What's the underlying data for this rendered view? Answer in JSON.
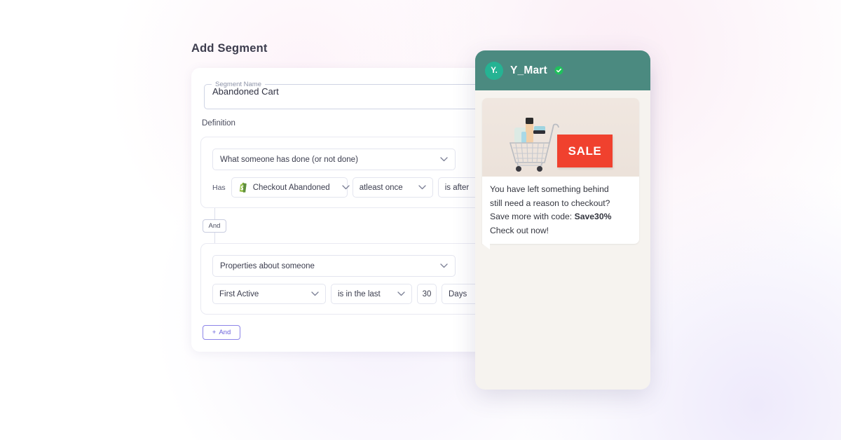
{
  "page": {
    "title": "Add Segment"
  },
  "segment_form": {
    "name_field": {
      "legend": "Segment Name",
      "value": "Abandoned Cart"
    },
    "definition_label": "Definition",
    "rules": [
      {
        "primary_select": "What someone has done (or not done)",
        "prefix_label": "Has",
        "event": "Checkout Abandoned",
        "event_icon": "shopify-icon",
        "frequency": "atleast once",
        "time_operator": "is after"
      },
      {
        "primary_select": "Properties about someone",
        "property": "First Active",
        "operator": "is in the last",
        "amount": "30",
        "unit": "Days"
      }
    ],
    "connector_label": "And",
    "add_condition_button": "+ And",
    "add_condition_plus": "+",
    "add_condition_text": "And"
  },
  "preview": {
    "brand": {
      "avatar_initials": "Y.",
      "name": "Y_Mart",
      "verified_icon": "verified-check-icon"
    },
    "message": {
      "image_alt": "shopping-cart-with-sale-sign",
      "sale_tag": "SALE",
      "line1": "You have left something behind",
      "line2": "still need a reason to checkout?",
      "line3_prefix": "Save more with code: ",
      "line3_code": "Save30%",
      "line4": "Check out now!"
    }
  },
  "colors": {
    "header_teal": "#4b8a80",
    "avatar_green": "#25b393",
    "verified_green": "#1fc25c",
    "sale_red": "#f0412e",
    "accent_purple": "#6b62db",
    "phone_bg": "#f6f3ef"
  }
}
